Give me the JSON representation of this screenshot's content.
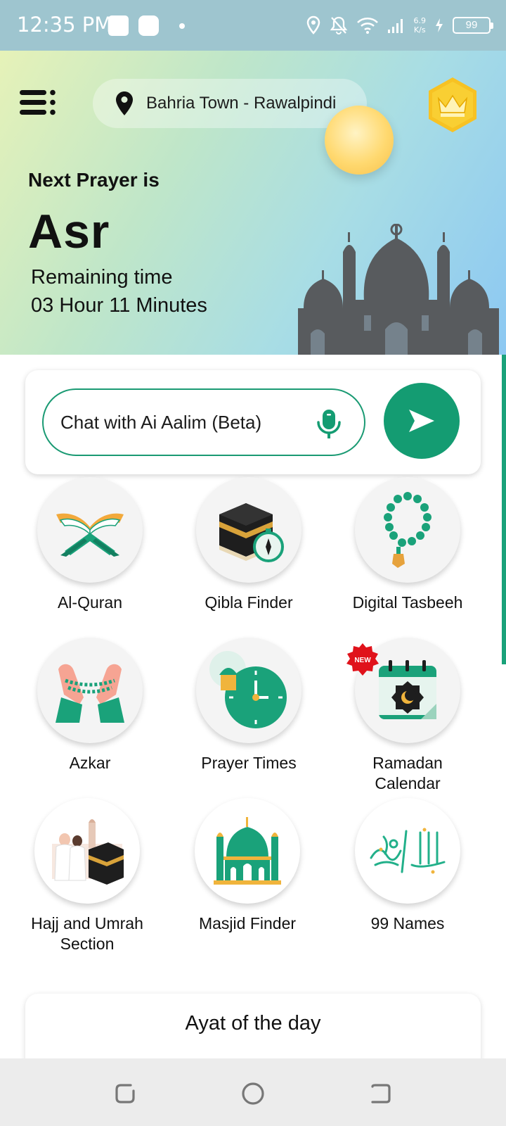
{
  "status": {
    "time": "12:35 PM",
    "speed_top": "6.9",
    "speed_bottom": "K/s",
    "battery": "99"
  },
  "header": {
    "location": "Bahria Town - Rawalpindi"
  },
  "prayer": {
    "next_label": "Next Prayer is",
    "name": "Asr",
    "remaining_label": "Remaining time",
    "remaining_value": "03 Hour 11 Minutes"
  },
  "chat": {
    "placeholder": "Chat with Ai Aalim (Beta)"
  },
  "features": [
    {
      "label": "Al-Quran"
    },
    {
      "label": "Qibla Finder"
    },
    {
      "label": "Digital Tasbeeh"
    },
    {
      "label": "Azkar"
    },
    {
      "label": "Prayer Times"
    },
    {
      "label": "Ramadan Calendar",
      "badge": "NEW"
    },
    {
      "label": "Hajj and Umrah Section"
    },
    {
      "label": "Masjid Finder"
    },
    {
      "label": "99 Names"
    }
  ],
  "ayat": {
    "title": "Ayat of the day"
  },
  "colors": {
    "accent": "#149c72",
    "badge": "#e0121b"
  }
}
